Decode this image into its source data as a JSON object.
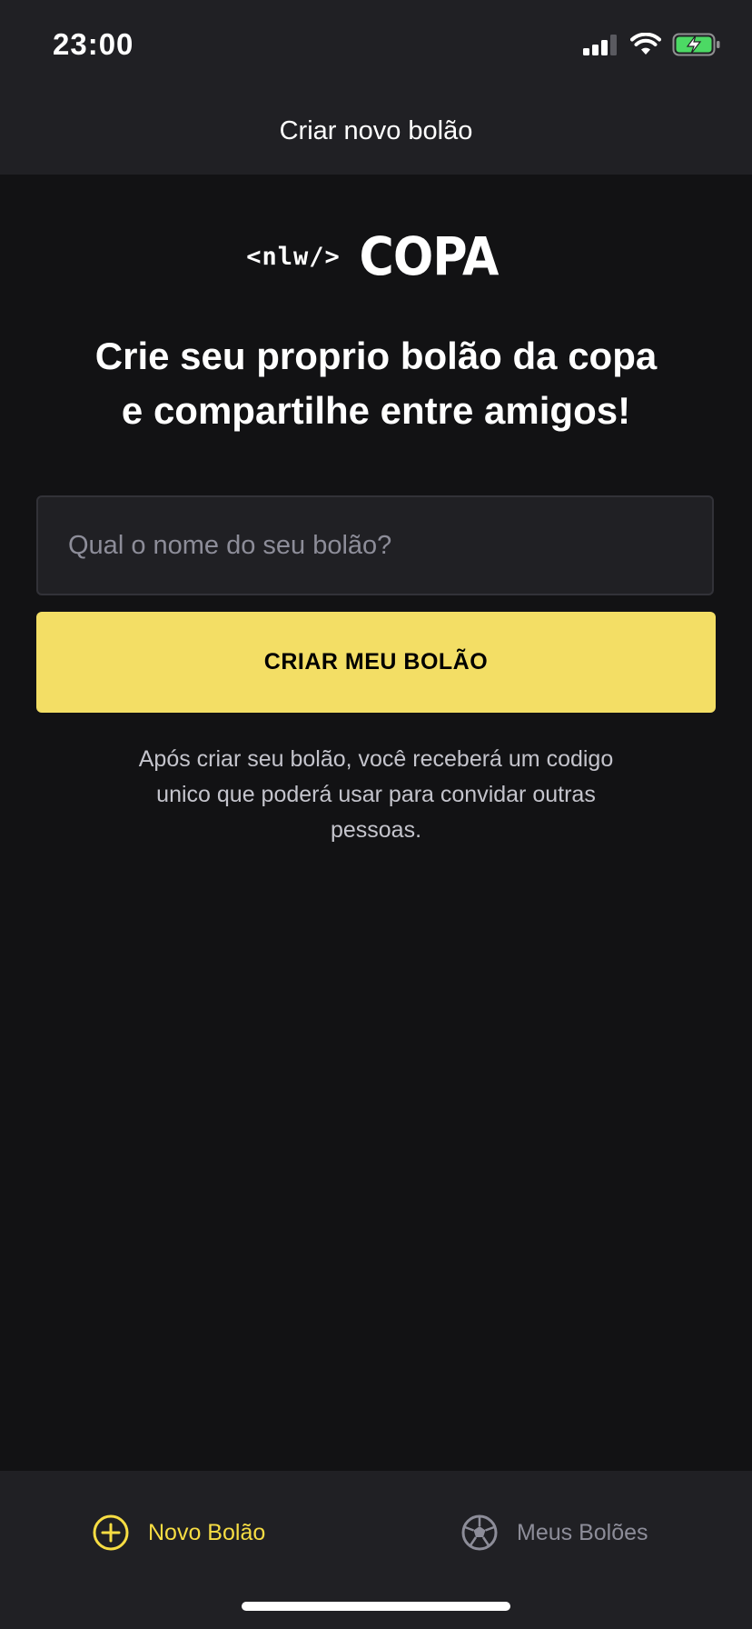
{
  "status_bar": {
    "time": "23:00"
  },
  "header": {
    "title": "Criar novo bolão"
  },
  "logo": {
    "nlw": "<nlw/>",
    "copa": "COPA"
  },
  "headline": {
    "line1": "Crie seu proprio bolão da copa",
    "line2": "e compartilhe entre amigos!"
  },
  "form": {
    "input_placeholder": "Qual o nome do seu bolão?",
    "input_value": "",
    "button_label": "CRIAR MEU BOLÃO"
  },
  "info_text": "Após criar seu bolão, você receberá um codigo unico que poderá usar para convidar outras pessoas.",
  "tabs": [
    {
      "label": "Novo Bolão",
      "icon": "plus-circle-icon",
      "active": true
    },
    {
      "label": "Meus Bolões",
      "icon": "soccer-ball-icon",
      "active": false
    }
  ],
  "colors": {
    "accent": "#F7DD43",
    "background": "#121214",
    "surface": "#202024",
    "muted": "#8D8D99"
  }
}
